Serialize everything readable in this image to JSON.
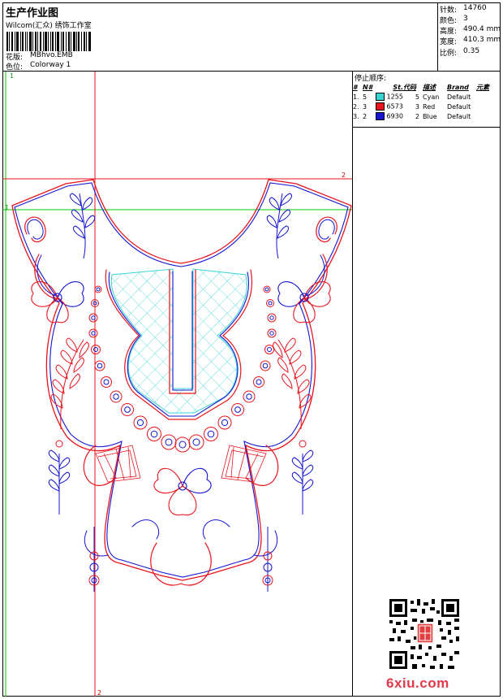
{
  "header": {
    "title": "生产作业图",
    "company": "Wilcom(汇众) 绣饰工作室",
    "fields": [
      {
        "label": "花版:",
        "value": "MBhvo.EMB"
      },
      {
        "label": "色位:",
        "value": "Colorway 1"
      }
    ]
  },
  "stats": [
    {
      "label": "针数:",
      "value": "14760"
    },
    {
      "label": "颜色:",
      "value": "3"
    },
    {
      "label": "高度:",
      "value": "490.4 mm"
    },
    {
      "label": "宽度:",
      "value": "410.3 mm"
    },
    {
      "label": "比例:",
      "value": "0.35"
    }
  ],
  "stop_sequence": {
    "title": "停止顺序:",
    "columns": [
      "#",
      "N#",
      "St.",
      "代码",
      "描述",
      "Brand",
      "元素"
    ],
    "rows": [
      {
        "num": "1.",
        "needle": "5",
        "color": "#39d4d4",
        "stitches": "1255",
        "code": "5",
        "desc": "Cyan",
        "brand": "Default"
      },
      {
        "num": "2.",
        "needle": "3",
        "color": "#e8141e",
        "stitches": "6573",
        "code": "3",
        "desc": "Red",
        "brand": "Default"
      },
      {
        "num": "3.",
        "needle": "2",
        "color": "#1414d2",
        "stitches": "6930",
        "code": "2",
        "desc": "Blue",
        "brand": "Default"
      }
    ]
  },
  "guides": {
    "vertical_green_label": "1",
    "horizontal_green_label": "1",
    "horizontal_red_label": "2",
    "vertical_red_label": "2"
  },
  "colors": {
    "red": "#e8141e",
    "blue": "#1414d2",
    "cyan": "#39d4d4",
    "guide_green": "#00c800",
    "guide_red": "#e8141e"
  },
  "watermark": "6xiu.com"
}
